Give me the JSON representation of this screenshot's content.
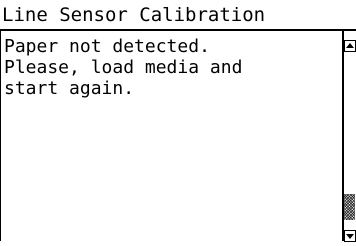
{
  "window": {
    "title": "Line Sensor Calibration"
  },
  "message": {
    "lines": [
      "Paper not detected.",
      "Please, load media and",
      "start again."
    ]
  },
  "scrollbar": {
    "up_icon": "arrow-up-icon",
    "down_icon": "arrow-down-icon",
    "thumb_position_fraction": 0.85
  },
  "colors": {
    "background": "#ffffff",
    "foreground": "#000000",
    "thumb_pattern": "#555555"
  }
}
